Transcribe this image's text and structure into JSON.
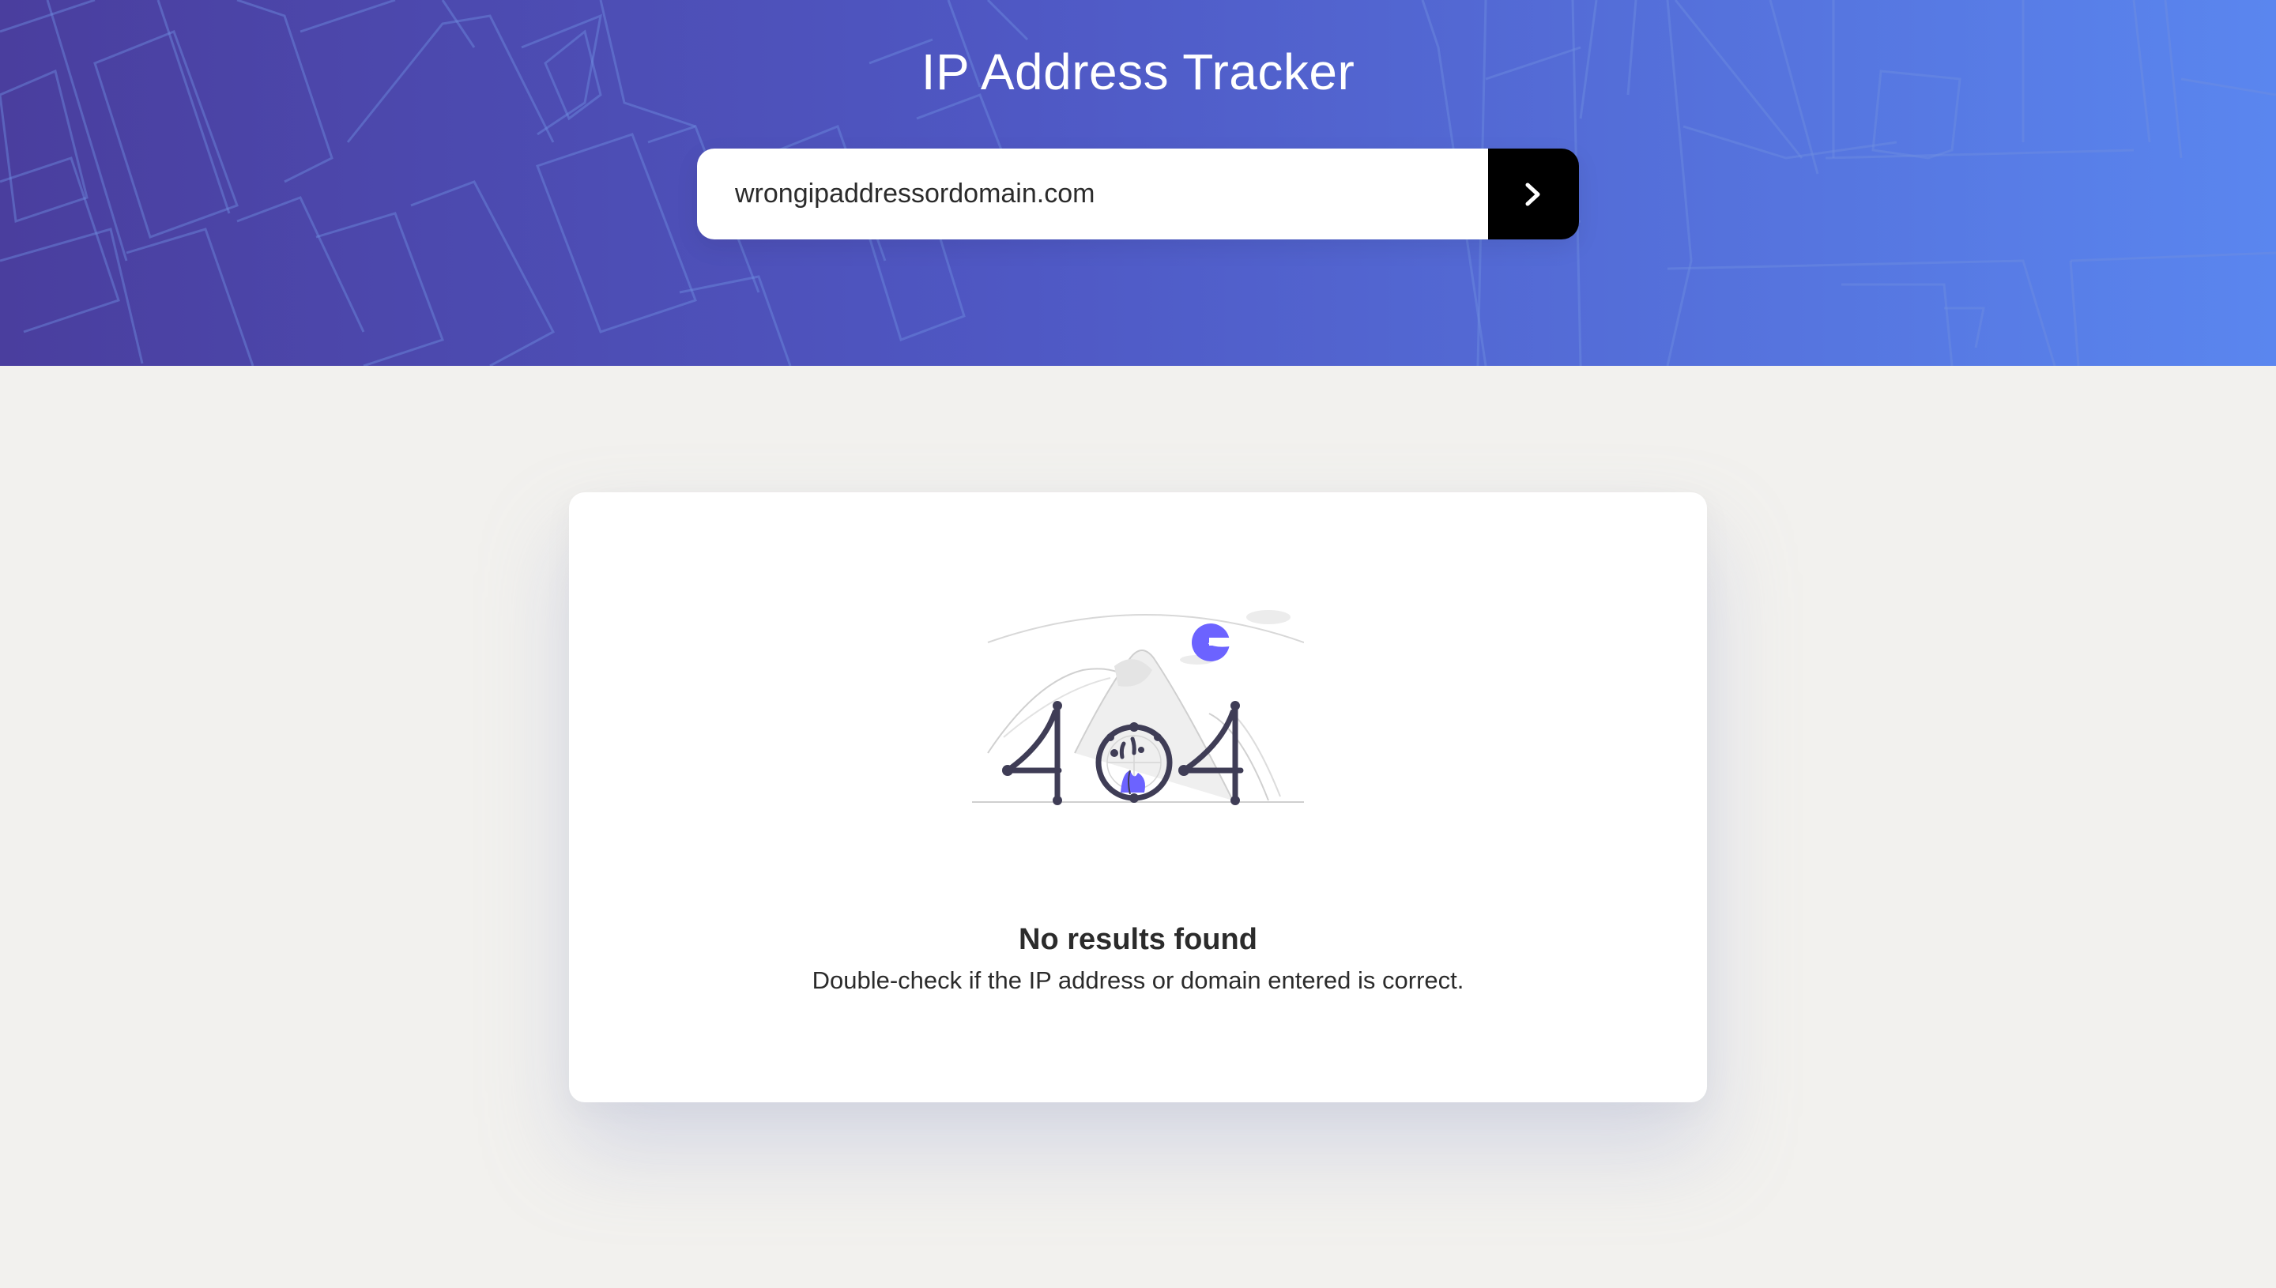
{
  "header": {
    "title": "IP Address Tracker"
  },
  "search": {
    "value": "wrongipaddressordomain.com",
    "submit_icon": "chevron-right-icon"
  },
  "result": {
    "illustration": "404-illustration",
    "title": "No results found",
    "message": "Double-check if the IP address or domain entered is correct."
  },
  "colors": {
    "header_gradient_start": "#4a3e9e",
    "header_gradient_end": "#5a86ef",
    "accent": "#6c63ff",
    "page_background": "#f2f1ee",
    "button": "#000000"
  }
}
